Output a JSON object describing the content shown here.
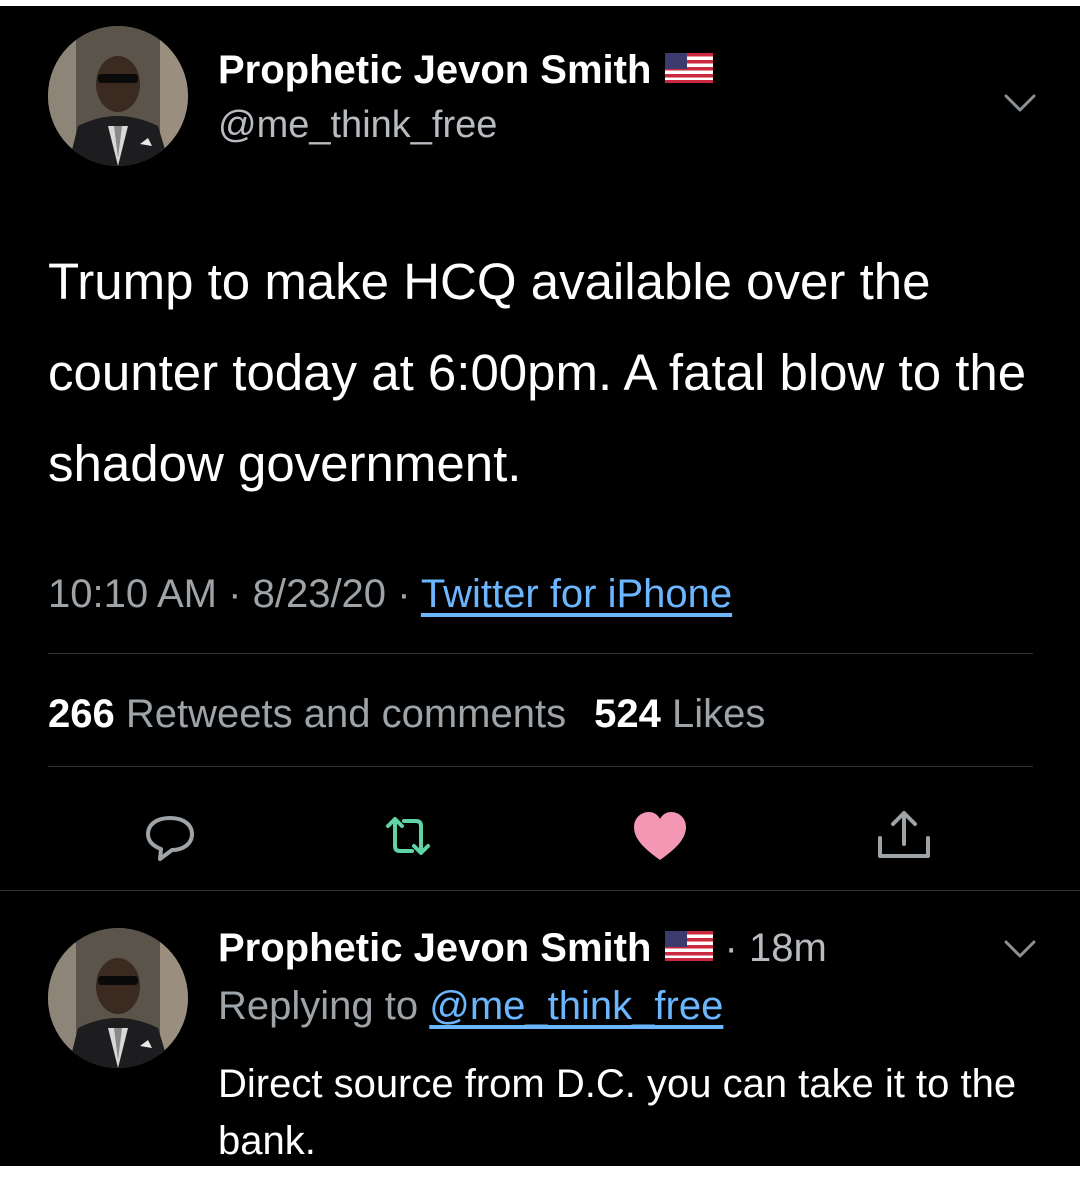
{
  "tweet": {
    "author_name": "Prophetic Jevon Smith",
    "author_handle": "@me_think_free",
    "flag_icon": "us-flag-icon",
    "text": "Trump to make HCQ available over the counter today at 6:00pm. A fatal blow to the shadow government.",
    "time": "10:10 AM",
    "date": "8/23/20",
    "separator": "·",
    "source": "Twitter for iPhone",
    "retweets_count": "266",
    "retweets_label": "Retweets and comments",
    "likes_count": "524",
    "likes_label": "Likes",
    "liked": true,
    "colors": {
      "background": "#000000",
      "link": "#6cb6ff",
      "retweet": "#5fd3a3",
      "like": "#f497b5",
      "muted": "#9ea3a8"
    }
  },
  "reply": {
    "author_name": "Prophetic Jevon Smith",
    "time": "· 18m",
    "replying_label": "Replying to",
    "replying_handle": "@me_think_free",
    "text": "Direct source from D.C. you can take it to the bank."
  }
}
